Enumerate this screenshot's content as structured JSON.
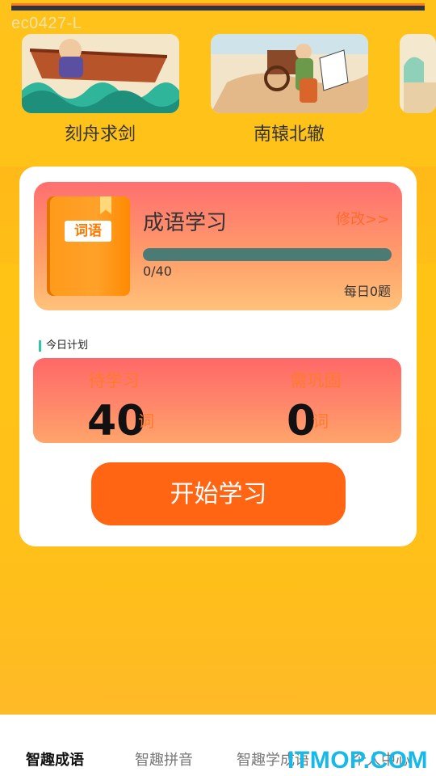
{
  "watermark": "ec0427-L",
  "stories": [
    {
      "label": "刻舟求剑",
      "image": "boat-on-waves-illustration"
    },
    {
      "label": "南辕北辙",
      "image": "horse-carriage-illustration"
    },
    {
      "label": "",
      "image": "partial-illustration"
    }
  ],
  "study": {
    "title": "成语学习",
    "edit": "修改>>",
    "book_tag": "词语",
    "progress_text": "0/40",
    "progress_fraction": 0,
    "daily": "每日0题"
  },
  "plan": {
    "label": "今日计划",
    "to_learn_label": "待学习",
    "to_learn_value": "40",
    "to_learn_unit": "词",
    "to_review_label": "需巩固",
    "to_review_value": "0",
    "to_review_unit": "词"
  },
  "start_button": "开始学习",
  "tabs": [
    {
      "label": "智趣成语",
      "active": true
    },
    {
      "label": "智趣拼音",
      "active": false
    },
    {
      "label": "智趣学成语",
      "active": false
    },
    {
      "label": "个人中心",
      "active": false
    }
  ],
  "brand": "ITMOP.COM",
  "colors": {
    "background": "#ffc21a",
    "accent": "#ff6513",
    "progress_track": "#4c7b76",
    "brand": "#17b9e8"
  }
}
